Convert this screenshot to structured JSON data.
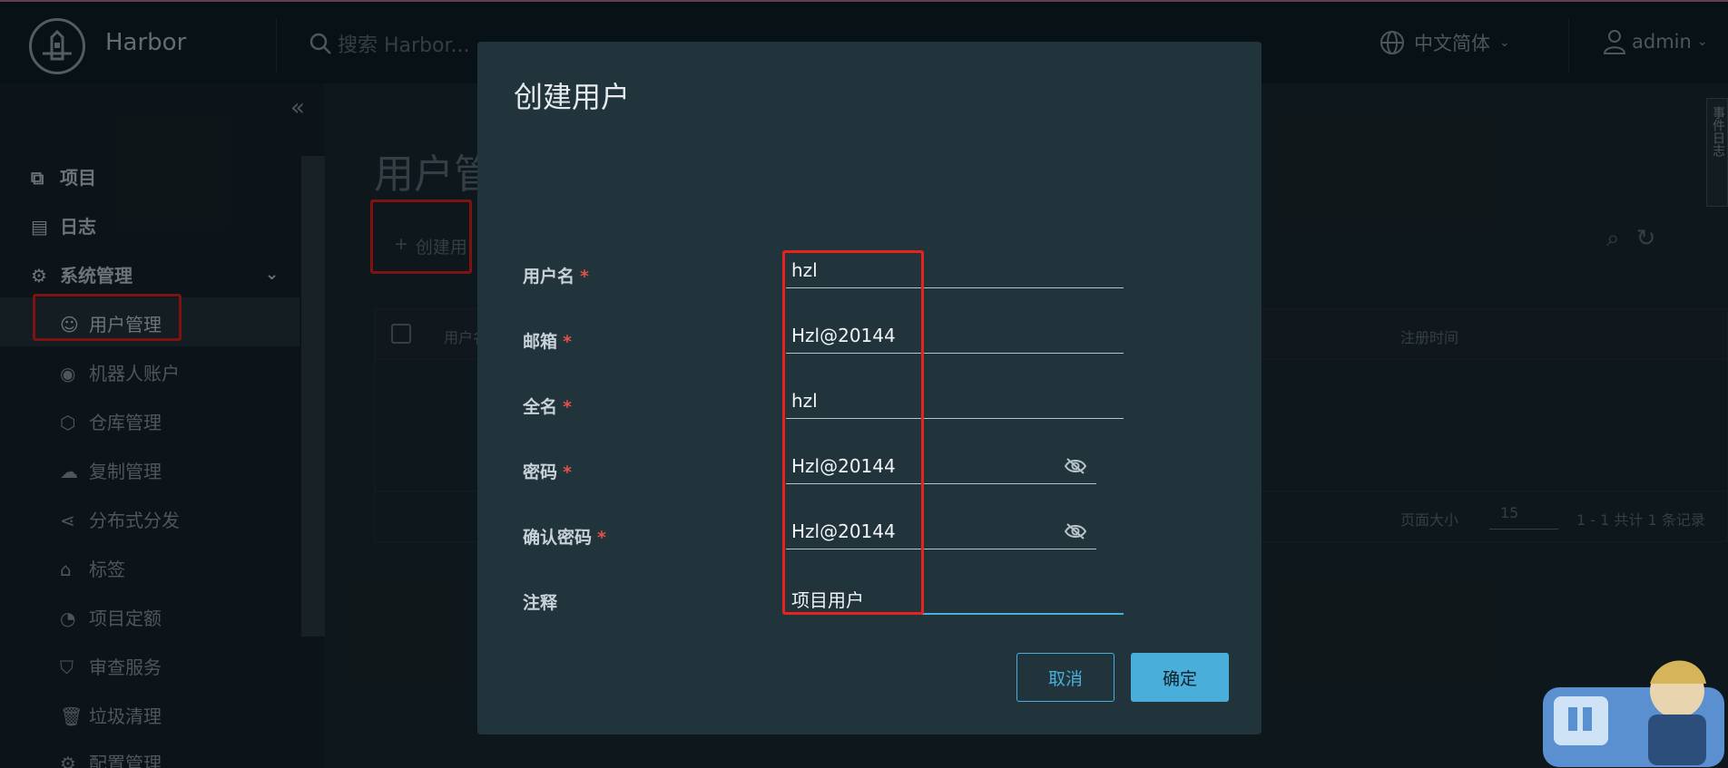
{
  "header": {
    "brand": "Harbor",
    "search_placeholder": "搜索 Harbor...",
    "language": "中文简体",
    "user": "admin"
  },
  "sidebar": {
    "items": [
      {
        "label": "项目",
        "icon": "project-icon"
      },
      {
        "label": "日志",
        "icon": "log-icon"
      },
      {
        "label": "系统管理",
        "icon": "admin-icon"
      },
      {
        "label": "用户管理",
        "icon": "users-icon"
      },
      {
        "label": "机器人账户",
        "icon": "robot-icon"
      },
      {
        "label": "仓库管理",
        "icon": "box-icon"
      },
      {
        "label": "复制管理",
        "icon": "cloud-icon"
      },
      {
        "label": "分布式分发",
        "icon": "share-icon"
      },
      {
        "label": "标签",
        "icon": "tag-icon"
      },
      {
        "label": "项目定额",
        "icon": "quota-icon"
      },
      {
        "label": "审查服务",
        "icon": "shield-icon"
      },
      {
        "label": "垃圾清理",
        "icon": "trash-icon"
      },
      {
        "label": "配置管理",
        "icon": "gear-icon"
      }
    ]
  },
  "main": {
    "title": "用户管",
    "create_button": "创建用",
    "columns": [
      "用户名",
      "注册时间"
    ],
    "page_size_label": "页面大小",
    "page_size": "15",
    "record_info": "1 - 1 共计 1 条记录",
    "side_tab": "事件日志"
  },
  "modal": {
    "title": "创建用户",
    "fields": [
      {
        "label": "用户名",
        "value": "hzl",
        "required": "*"
      },
      {
        "label": "邮箱",
        "value": "Hzl@20144",
        "required": "*"
      },
      {
        "label": "全名",
        "value": "hzl",
        "required": "*"
      },
      {
        "label": "密码",
        "value": "Hzl@20144",
        "required": "*"
      },
      {
        "label": "确认密码",
        "value": "Hzl@20144",
        "required": "*"
      },
      {
        "label": "注释",
        "value": "项目用户"
      }
    ],
    "cancel": "取消",
    "ok": "确定"
  },
  "colors": {
    "accent": "#49aeda",
    "annotation": "#e6231f",
    "required": "#e0514a"
  }
}
